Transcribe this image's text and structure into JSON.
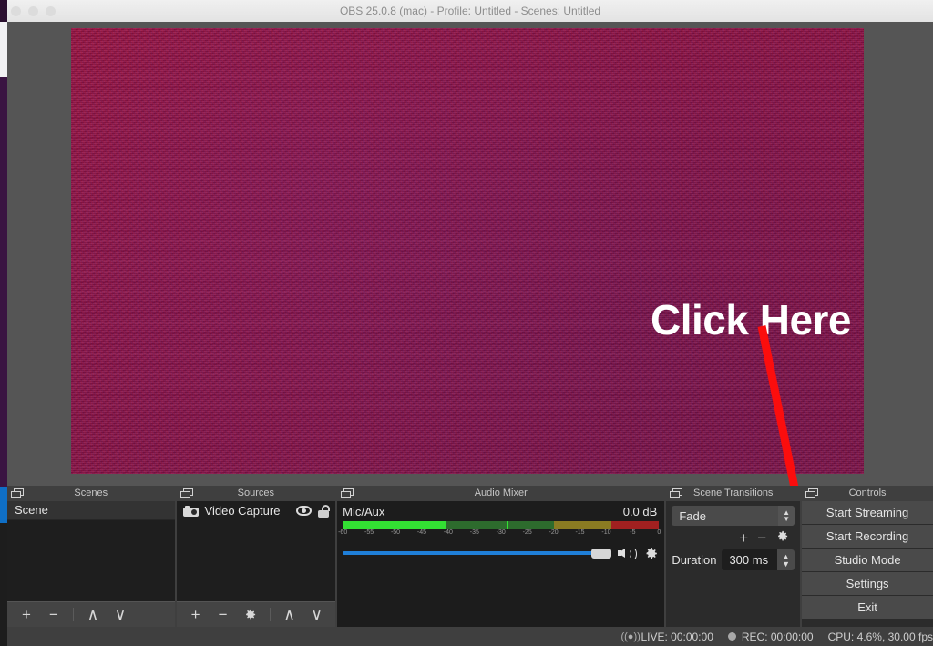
{
  "window": {
    "title": "OBS 25.0.8 (mac) - Profile: Untitled - Scenes: Untitled",
    "close_label": "close",
    "minimize_label": "minimize",
    "zoom_label": "zoom"
  },
  "annotation": {
    "text": "Click Here",
    "color": "#ffffff",
    "arrow_color": "#fb0d0d"
  },
  "preview": {
    "source_color": "#8e1040"
  },
  "scenes": {
    "title": "Scenes",
    "items": [
      {
        "label": "Scene",
        "selected": true
      }
    ],
    "toolbar": {
      "add": "+",
      "remove": "−",
      "move_up": "∧",
      "move_down": "∨"
    }
  },
  "sources": {
    "title": "Sources",
    "items": [
      {
        "label": "Video Capture",
        "type_icon": "camera-icon",
        "visible": true,
        "locked": false
      }
    ],
    "toolbar": {
      "add": "+",
      "remove": "−",
      "properties": "gear",
      "move_up": "∧",
      "move_down": "∨"
    }
  },
  "mixer": {
    "title": "Audio Mixer",
    "channels": [
      {
        "name": "Mic/Aux",
        "level_db": "0.0 dB",
        "volume_percent": 96,
        "meter": {
          "ticks": [
            -60,
            -55,
            -50,
            -45,
            -40,
            -35,
            -30,
            -25,
            -20,
            -15,
            -10,
            -5,
            0
          ],
          "min_db": -60,
          "max_db": 0,
          "peak_db": -40.5,
          "magnitude_db": -29.0,
          "segments": [
            {
              "from_db": -60,
              "to_db": -20,
              "color": "#2d6b2d"
            },
            {
              "from_db": -20,
              "to_db": -9,
              "color": "#8a7b22"
            },
            {
              "from_db": -9,
              "to_db": 0,
              "color": "#a02020"
            }
          ],
          "active_color": "#33e033"
        },
        "muted": false
      }
    ]
  },
  "transitions": {
    "title": "Scene Transitions",
    "selected": "Fade",
    "options": [
      "Fade"
    ],
    "add_label": "+",
    "remove_label": "−",
    "properties_label": "gear",
    "duration_label": "Duration",
    "duration_value": "300 ms"
  },
  "controls": {
    "title": "Controls",
    "buttons": [
      {
        "label": "Start Streaming"
      },
      {
        "label": "Start Recording"
      },
      {
        "label": "Studio Mode"
      },
      {
        "label": "Settings"
      },
      {
        "label": "Exit"
      }
    ]
  },
  "statusbar": {
    "live_label": "LIVE: 00:00:00",
    "rec_label": "REC: 00:00:00",
    "cpu_label": "CPU: 4.6%, 30.00 fps"
  }
}
